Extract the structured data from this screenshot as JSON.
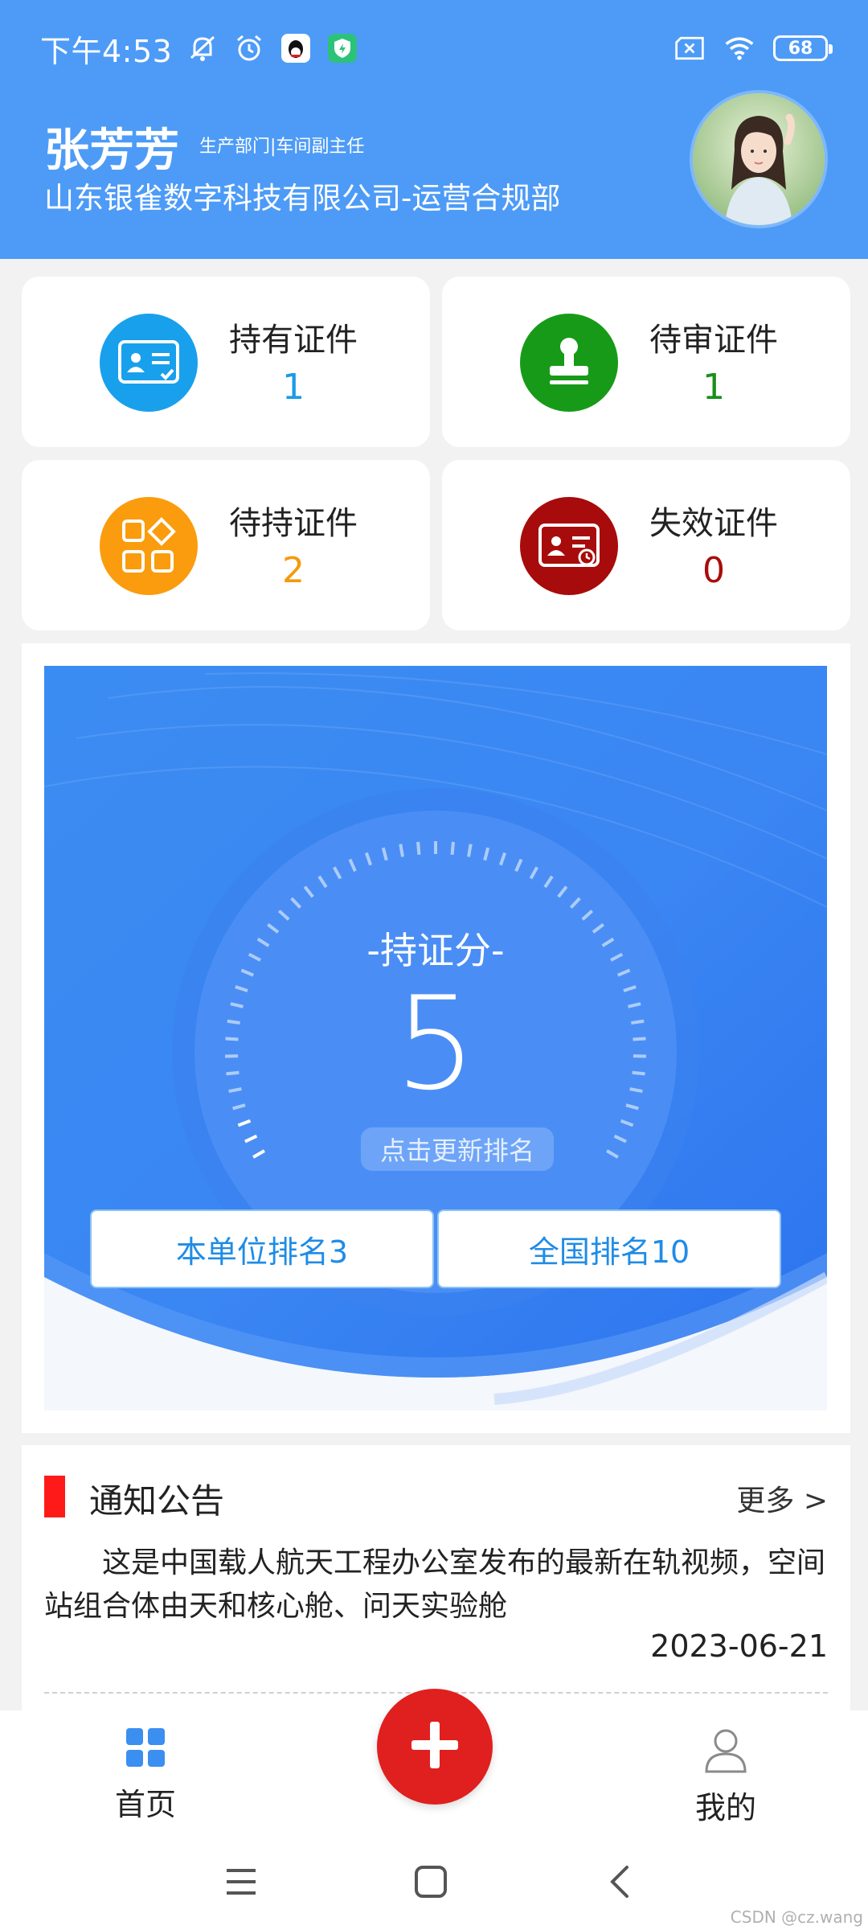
{
  "status_bar": {
    "time": "下午4:53",
    "battery": "68"
  },
  "profile": {
    "name": "张芳芳",
    "title": "生产部门|车间副主任",
    "company": "山东银雀数字科技有限公司-运营合规部"
  },
  "stats": [
    {
      "label": "持有证件",
      "count": "1",
      "color": "#1a9be6",
      "icon": "id-card-icon"
    },
    {
      "label": "待审证件",
      "count": "1",
      "color": "#1a8f1a",
      "icon": "stamp-icon"
    },
    {
      "label": "待持证件",
      "count": "2",
      "color": "#f59a0c",
      "icon": "grid-icon"
    },
    {
      "label": "失效证件",
      "count": "0",
      "color": "#a80c0c",
      "icon": "expired-card-icon"
    }
  ],
  "score": {
    "title": "-持证分-",
    "value": "5",
    "refresh_label": "点击更新排名",
    "unit_rank_label": "本单位排名3",
    "national_rank_label": "全国排名10"
  },
  "notice": {
    "heading": "通知公告",
    "more": "更多 >",
    "text": "这是中国载人航天工程办公室发布的最新在轨视频，空间站组合体由天和核心舱、问天实验舱",
    "date": "2023-06-21"
  },
  "tabbar": {
    "home_label": "首页",
    "mine_label": "我的"
  },
  "watermark": "CSDN @cz.wang",
  "colors": {
    "header": "#4d9bf7",
    "fab": "#e01f1f",
    "accent": "#1f8ce6"
  }
}
